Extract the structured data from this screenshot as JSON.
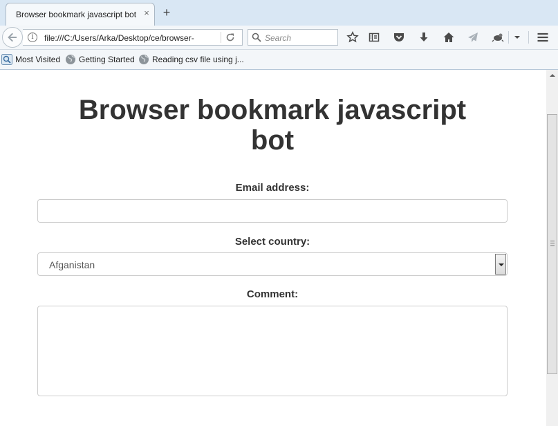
{
  "browser": {
    "tab": {
      "title": "Browser bookmark javascript bot",
      "close_glyph": "×"
    },
    "new_tab_glyph": "+",
    "url": "file:///C:/Users/Arka/Desktop/ce/browser-",
    "info_glyph": "i",
    "search": {
      "placeholder": "Search"
    },
    "toolbar_icons": [
      "star-icon",
      "reading-list-icon",
      "pocket-icon",
      "download-icon",
      "home-icon",
      "send-icon",
      "extension-icon",
      "dropdown-icon",
      "menu-icon"
    ]
  },
  "bookmarks": [
    {
      "label": "Most Visited",
      "icon": "most-visited-icon"
    },
    {
      "label": "Getting Started",
      "icon": "globe-icon"
    },
    {
      "label": "Reading csv file using j...",
      "icon": "globe-icon"
    }
  ],
  "page": {
    "title_line1": "Browser bookmark javascript",
    "title_line2": "bot",
    "email": {
      "label": "Email address:",
      "value": ""
    },
    "country": {
      "label": "Select country:",
      "selected": "Afganistan"
    },
    "comment": {
      "label": "Comment:",
      "value": ""
    }
  },
  "colors": {
    "tabstrip": "#d9e7f4",
    "toolbar": "#f3f6f9",
    "heading_text": "#333333",
    "input_border": "#cccccc"
  }
}
